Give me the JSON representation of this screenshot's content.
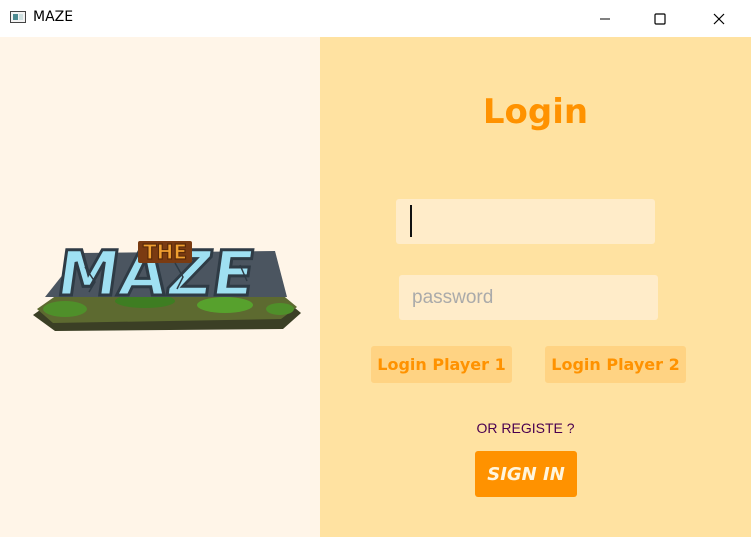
{
  "window": {
    "title": "MAZE",
    "icon": "app-window-icon",
    "controls": [
      "minimize-icon",
      "maximize-icon",
      "close-icon"
    ]
  },
  "logo": {
    "text_top": "THE",
    "text_main": "MAZE",
    "icon": "the-maze-logo"
  },
  "login": {
    "title": "Login",
    "username_value": "",
    "password_placeholder": "password",
    "player1_label": "Login Player 1",
    "player2_label": "Login Player 2",
    "register_text": "OR REGISTE ?",
    "signin_label": "SIGN IN"
  },
  "colors": {
    "left_bg": "#fff5e8",
    "right_bg": "#ffe2a1",
    "accent": "#ff9200",
    "input_bg": "#ffecc9",
    "button_bg": "#ffd383",
    "register_text": "#4a0050"
  }
}
